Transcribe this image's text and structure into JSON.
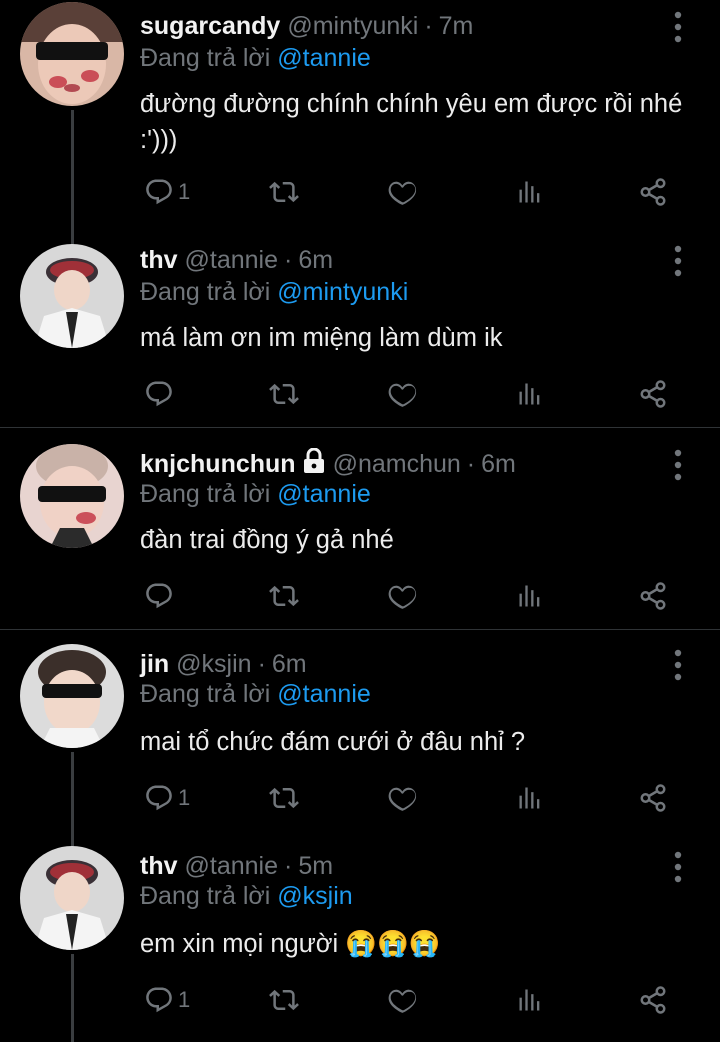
{
  "colors": {
    "background": "#000000",
    "muted": "#71767b",
    "mention": "#1d9bf0",
    "divider": "#2f3336"
  },
  "tweets": [
    {
      "name": "sugarcandy",
      "handle": "@mintyunki",
      "time": "7m",
      "locked": false,
      "reply_prefix": "Đang trả lời",
      "reply_to": "@tannie",
      "text": "đường đường chính chính yêu em được rồi nhé :')))",
      "reply_count": "1",
      "avatar_icon": "avatar-sugarcandy"
    },
    {
      "name": "thv",
      "handle": "@tannie",
      "time": "6m",
      "locked": false,
      "reply_prefix": "Đang trả lời",
      "reply_to": "@mintyunki",
      "text": "má làm ơn im miệng làm dùm ik",
      "reply_count": "",
      "avatar_icon": "avatar-thv"
    },
    {
      "name": "knjchunchun",
      "handle": "@namchun",
      "time": "6m",
      "locked": true,
      "reply_prefix": "Đang trả lời",
      "reply_to": "@tannie",
      "text": "đàn trai đồng ý gả nhé",
      "reply_count": "",
      "avatar_icon": "avatar-knjchunchun"
    },
    {
      "name": "jin",
      "handle": "@ksjin",
      "time": "6m",
      "locked": false,
      "reply_prefix": "Đang trả lời",
      "reply_to": "@tannie",
      "text": "mai tổ chức đám cưới ở đâu nhỉ ?",
      "reply_count": "1",
      "avatar_icon": "avatar-jin"
    },
    {
      "name": "thv",
      "handle": "@tannie",
      "time": "5m",
      "locked": false,
      "reply_prefix": "Đang trả lời",
      "reply_to": "@ksjin",
      "text": "em xin mọi người 😭😭😭",
      "reply_count": "1",
      "avatar_icon": "avatar-thv"
    }
  ],
  "separator": "·"
}
